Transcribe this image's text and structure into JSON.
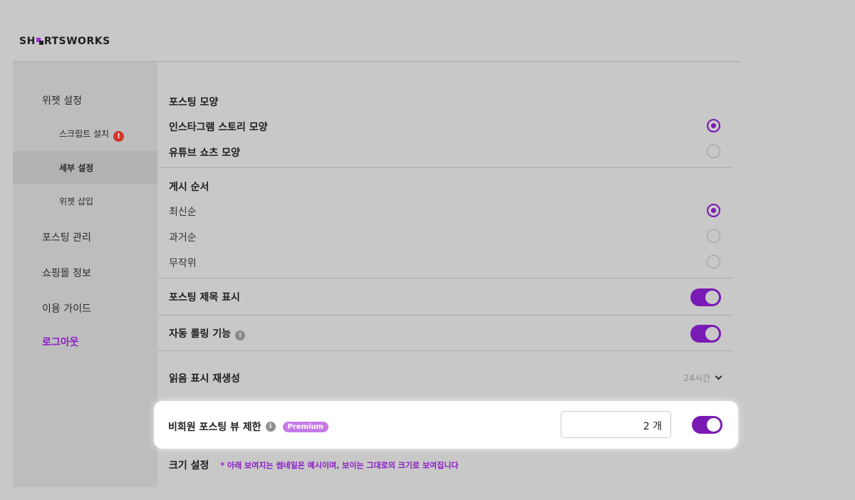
{
  "brand": {
    "name_left": "SH",
    "name_right": "RTSWORKS"
  },
  "sidebar": {
    "items": [
      {
        "label": "위젯 설정"
      },
      {
        "label": "스크립트 설치",
        "alert": "!"
      },
      {
        "label": "세부 설정"
      },
      {
        "label": "위젯 삽입"
      },
      {
        "label": "포스팅 관리"
      },
      {
        "label": "쇼핑몰 정보"
      },
      {
        "label": "이용 가이드"
      },
      {
        "label": "로그아웃"
      }
    ]
  },
  "settings": {
    "posting_shape": {
      "title": "포스팅 모양",
      "options": [
        {
          "label": "인스타그램 스토리 모양",
          "selected": true
        },
        {
          "label": "유튜브 쇼츠 모양",
          "selected": false
        }
      ]
    },
    "post_order": {
      "title": "게시 순서",
      "options": [
        {
          "label": "최신순",
          "selected": true
        },
        {
          "label": "과거순",
          "selected": false
        },
        {
          "label": "무작위",
          "selected": false
        }
      ]
    },
    "show_title": {
      "label": "포스팅 제목 표시",
      "enabled": true
    },
    "auto_roll": {
      "label": "자동 롤링 기능",
      "info_icon": "i",
      "enabled": true
    },
    "read_regen": {
      "label": "읽음 표시 재생성",
      "value": "24시간"
    },
    "guest_limit": {
      "label": "비회원 포스팅 뷰 제한",
      "info_icon": "i",
      "badge": "Premium",
      "value": "2 개",
      "enabled": true
    },
    "size": {
      "label": "크기 설정",
      "note": "* 아래 보여지는 썸네일은 예시이며, 보이는 그대로의 크기로 보여집니다"
    }
  },
  "colors": {
    "accent": "#7a1ab5",
    "background": "#c8c8c8",
    "sidebar": "#bdbdbd",
    "alert": "#d4342a",
    "premium": "#c77be6"
  }
}
